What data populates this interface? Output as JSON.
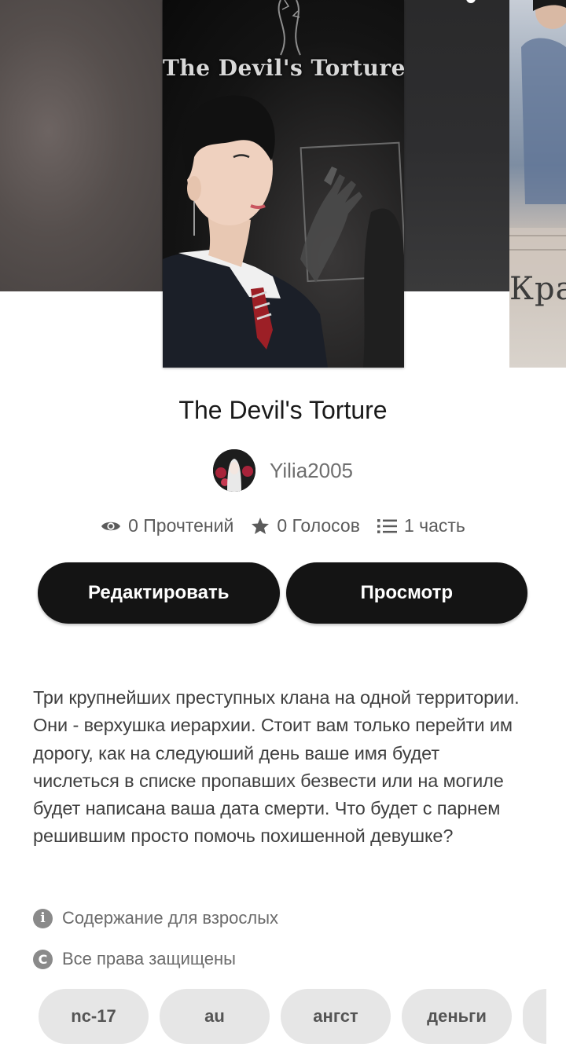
{
  "book": {
    "cover_title": "The Devil's Torture",
    "title": "The Devil's Torture",
    "next_cover_text": "Крас",
    "author": "Yilia2005"
  },
  "stats": {
    "reads": "0 Прочтений",
    "votes": "0 Голосов",
    "parts": "1 часть"
  },
  "actions": {
    "edit_label": "Редактировать",
    "view_label": "Просмотр"
  },
  "description": "Три крупнейших преступных клана на одной территории. Они - верхушка иерархии. Стоит вам только перейти им дорогу, как на следуюший день ваше имя будет числеться в списке пропавших безвести или на могиле будет написана ваша дата смерти. Что будет с парнем решившим просто помочь похишенной девушке?",
  "meta": {
    "mature_label": "Содержание для взрослых",
    "copyright_label": "Все права защищены",
    "info_icon": "info-icon",
    "copyright_icon": "copyright-icon"
  },
  "tags": [
    "nc-17",
    "au",
    "ангст",
    "деньги"
  ],
  "colors": {
    "button_bg": "#141414",
    "tag_bg": "#e6e6e6",
    "text_muted": "#6b6b6b"
  }
}
